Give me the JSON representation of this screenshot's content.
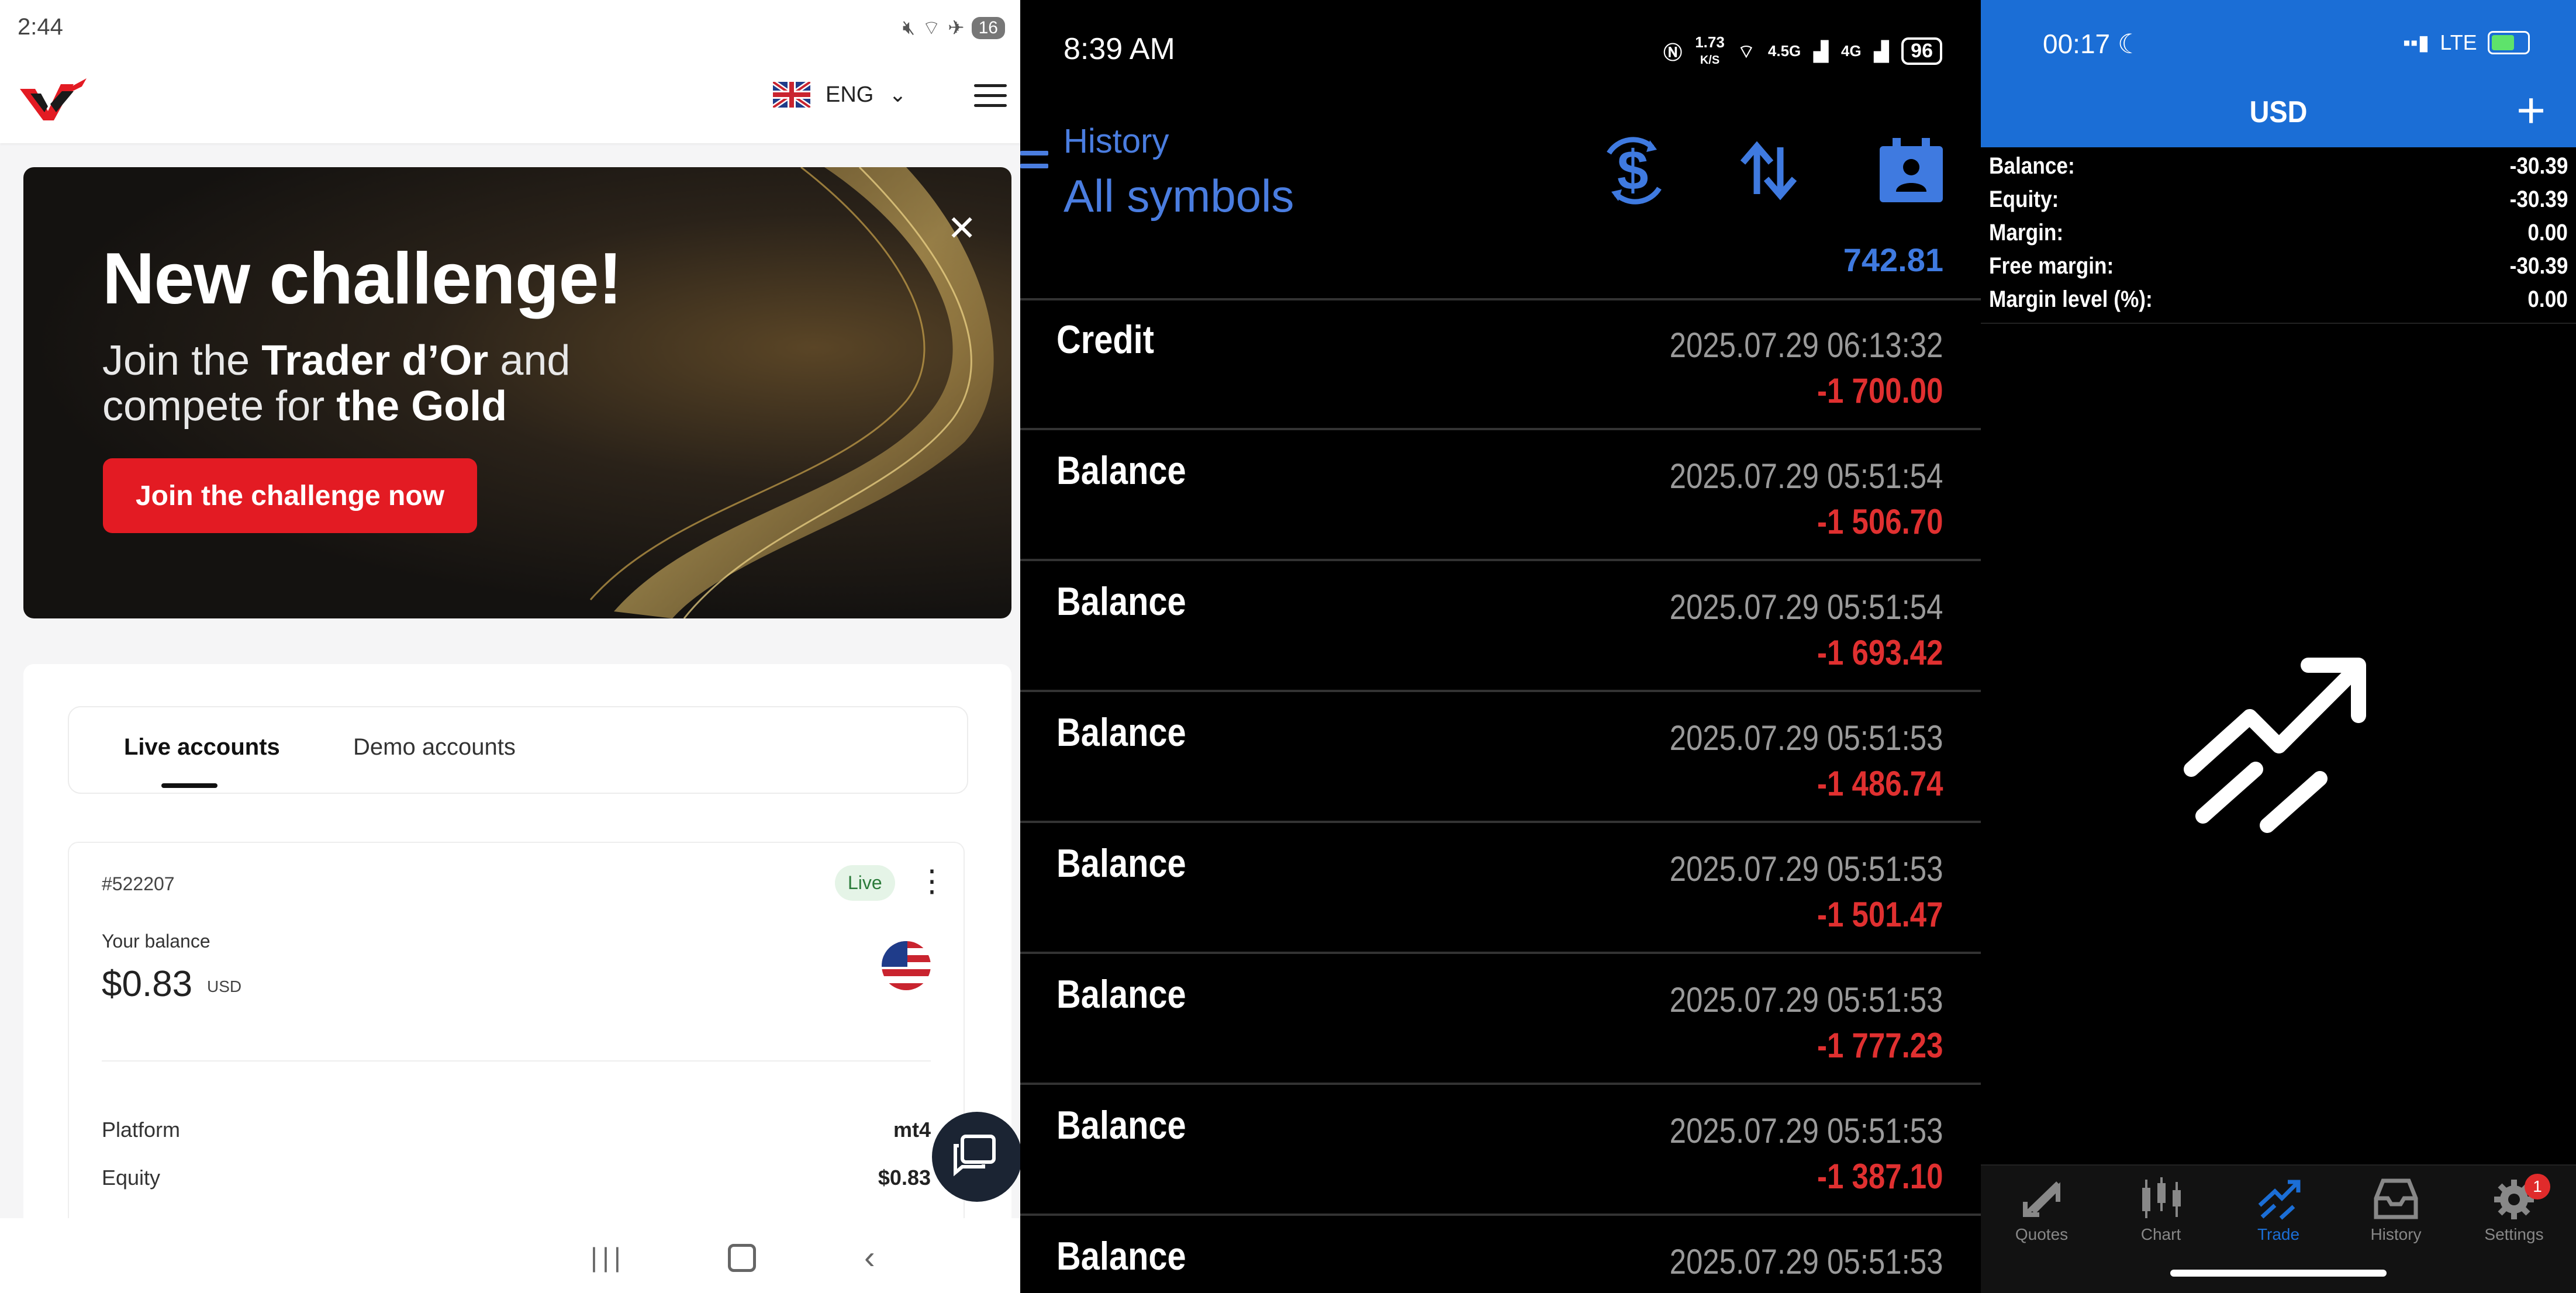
{
  "panel_broker": {
    "status": {
      "time": "2:44",
      "battery": "16"
    },
    "header": {
      "language": "ENG"
    },
    "banner": {
      "title": "New challenge!",
      "line1_pre": "Join the ",
      "line1_bold": "Trader d’Or",
      "line1_post": " and",
      "line2_pre": "compete for ",
      "line2_bold": "the Gold",
      "button": "Join the challenge now"
    },
    "tabs": {
      "live": "Live accounts",
      "demo": "Demo accounts"
    },
    "account": {
      "id": "#522207",
      "status": "Live",
      "balance_label": "Your balance",
      "balance": "$0.83",
      "currency": "USD",
      "rows": [
        {
          "label": "Platform",
          "value": "mt4"
        },
        {
          "label": "Equity",
          "value": "$0.83"
        }
      ]
    }
  },
  "panel_history": {
    "status": {
      "time": "8:39 AM",
      "speed_top": "1.73",
      "speed_bottom": "K/S",
      "net1": "4.5G",
      "net2": "4G",
      "battery": "96"
    },
    "title": "History",
    "subtitle": "All symbols",
    "total": "742.81",
    "deals": [
      {
        "type": "Credit",
        "time": "2025.07.29 06:13:32",
        "amount": "-1 700.00"
      },
      {
        "type": "Balance",
        "time": "2025.07.29 05:51:54",
        "amount": "-1 506.70"
      },
      {
        "type": "Balance",
        "time": "2025.07.29 05:51:54",
        "amount": "-1 693.42"
      },
      {
        "type": "Balance",
        "time": "2025.07.29 05:51:53",
        "amount": "-1 486.74"
      },
      {
        "type": "Balance",
        "time": "2025.07.29 05:51:53",
        "amount": "-1 501.47"
      },
      {
        "type": "Balance",
        "time": "2025.07.29 05:51:53",
        "amount": "-1 777.23"
      },
      {
        "type": "Balance",
        "time": "2025.07.29 05:51:53",
        "amount": "-1 387.10"
      },
      {
        "type": "Balance",
        "time": "2025.07.29 05:51:53",
        "amount": ""
      }
    ],
    "colors": {
      "accent": "#4a7de0",
      "negative": "#e03030"
    }
  },
  "panel_trade": {
    "status": {
      "time": "00:17",
      "network": "LTE"
    },
    "title": "USD",
    "rows": [
      {
        "label": "Balance:",
        "value": "-30.39"
      },
      {
        "label": "Equity:",
        "value": "-30.39"
      },
      {
        "label": "Margin:",
        "value": "0.00"
      },
      {
        "label": "Free margin:",
        "value": "-30.39"
      },
      {
        "label": "Margin level (%):",
        "value": "0.00"
      }
    ],
    "tabs": [
      {
        "label": "Quotes",
        "icon": "quotes-icon"
      },
      {
        "label": "Chart",
        "icon": "candles-icon"
      },
      {
        "label": "Trade",
        "icon": "trend-icon",
        "active": true
      },
      {
        "label": "History",
        "icon": "inbox-icon"
      },
      {
        "label": "Settings",
        "icon": "gear-icon",
        "badge": "1"
      }
    ],
    "colors": {
      "header": "#1b6ed6"
    }
  }
}
